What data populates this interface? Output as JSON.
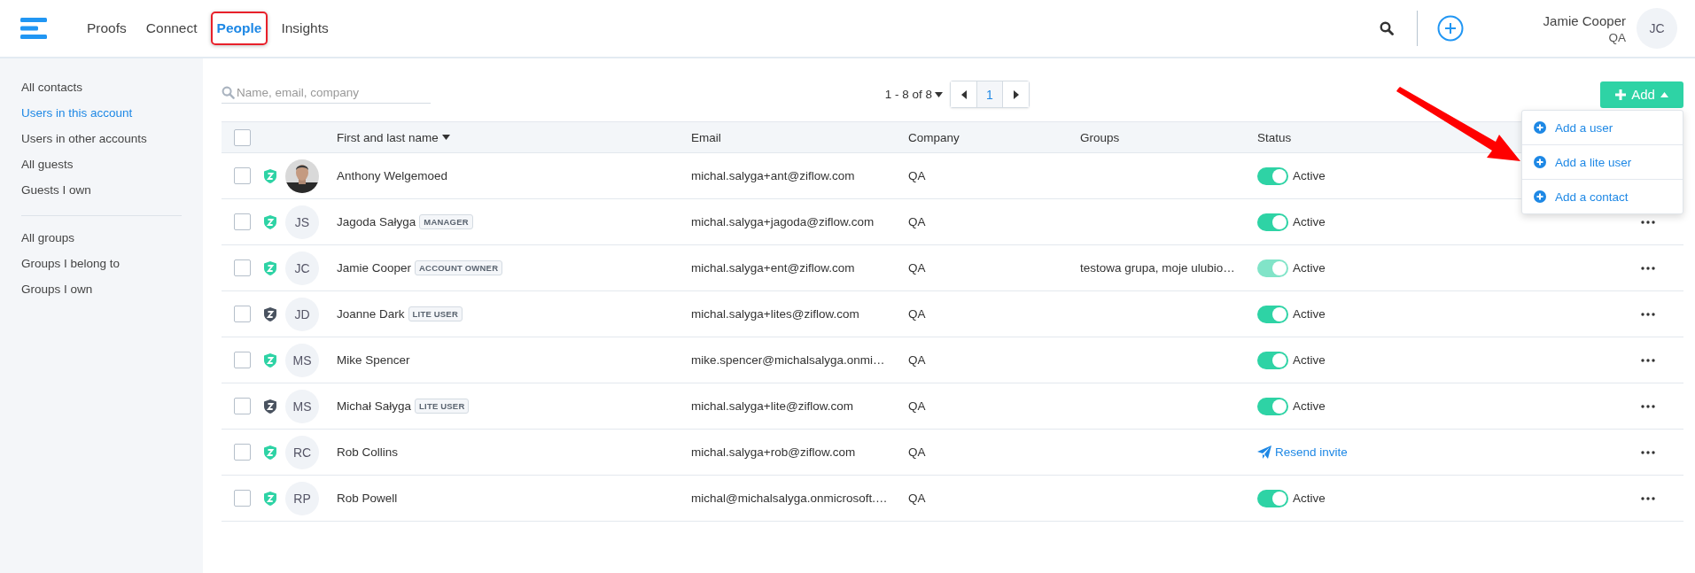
{
  "nav": {
    "items": [
      {
        "label": "Proofs",
        "selected": false,
        "highlighted": false
      },
      {
        "label": "Connect",
        "selected": false,
        "highlighted": false
      },
      {
        "label": "People",
        "selected": true,
        "highlighted": true
      },
      {
        "label": "Insights",
        "selected": false,
        "highlighted": false
      }
    ]
  },
  "user": {
    "name": "Jamie Cooper",
    "org": "QA",
    "initials": "JC"
  },
  "sidebar": {
    "sections": [
      [
        {
          "label": "All contacts",
          "selected": false
        },
        {
          "label": "Users in this account",
          "selected": true
        },
        {
          "label": "Users in other accounts",
          "selected": false
        },
        {
          "label": "All guests",
          "selected": false
        },
        {
          "label": "Guests I own",
          "selected": false
        }
      ],
      [
        {
          "label": "All groups",
          "selected": false
        },
        {
          "label": "Groups I belong to",
          "selected": false
        },
        {
          "label": "Groups I own",
          "selected": false
        }
      ]
    ]
  },
  "search": {
    "placeholder": "Name, email, company"
  },
  "pager": {
    "range": "1 - 8 of 8",
    "page": "1"
  },
  "add_button": {
    "label": "Add",
    "expanded": true
  },
  "add_menu": [
    {
      "label": "Add a user"
    },
    {
      "label": "Add a lite user"
    },
    {
      "label": "Add a contact"
    }
  ],
  "table": {
    "select_all_checked": false,
    "columns": [
      "First and last name",
      "Email",
      "Company",
      "Groups",
      "Status"
    ],
    "rows": [
      {
        "name": "Anthony Welgemoed",
        "color": "#2ed3a5",
        "checked": false,
        "email": "michal.salyga+ant@ziflow.com",
        "company": "QA",
        "status": {
          "kind": "toggle",
          "on": true,
          "disabled": false,
          "label": "Active"
        }
      },
      {
        "name": "Jagoda Sałyga",
        "badge": "MANAGER",
        "avatar": {
          "kind": "initials",
          "initials": "JS"
        },
        "color": "#2ed3a5",
        "checked": false,
        "email": "michal.salyga+jagoda@ziflow.com",
        "company": "QA",
        "status": {
          "kind": "toggle",
          "on": true,
          "disabled": false,
          "label": "Active"
        }
      },
      {
        "name": "Jamie Cooper",
        "badge": "ACCOUNT OWNER",
        "avatar": {
          "kind": "initials",
          "initials": "JC"
        },
        "color": "#2ed3a5",
        "checked": false,
        "email": "michal.salyga+ent@ziflow.com",
        "company": "QA",
        "groups": "testowa grupa, moje ulubio…",
        "status": {
          "kind": "toggle",
          "on": true,
          "disabled": true,
          "label": "Active"
        }
      },
      {
        "name": "Joanne Dark",
        "badge": "LITE USER",
        "avatar": {
          "kind": "initials",
          "initials": "JD"
        },
        "color": "#4a5360",
        "checked": false,
        "email": "michal.salyga+lites@ziflow.com",
        "company": "QA",
        "status": {
          "kind": "toggle",
          "on": true,
          "disabled": false,
          "label": "Active"
        }
      },
      {
        "name": "Mike Spencer",
        "avatar": {
          "kind": "initials",
          "initials": "MS"
        },
        "color": "#2ed3a5",
        "checked": false,
        "email": "mike.spencer@michalsalyga.onmi…",
        "company": "QA",
        "status": {
          "kind": "toggle",
          "on": true,
          "disabled": false,
          "label": "Active"
        }
      },
      {
        "name": "Michał Sałyga",
        "badge": "LITE USER",
        "avatar": {
          "kind": "initials",
          "initials": "MS"
        },
        "color": "#4a5360",
        "checked": false,
        "email": "michal.salyga+lite@ziflow.com",
        "company": "QA",
        "status": {
          "kind": "toggle",
          "on": true,
          "disabled": false,
          "label": "Active"
        }
      },
      {
        "name": "Rob Collins",
        "avatar": {
          "kind": "initials",
          "initials": "RC"
        },
        "color": "#2ed3a5",
        "checked": false,
        "email": "michal.salyga+rob@ziflow.com",
        "company": "QA",
        "status": {
          "kind": "resend",
          "label": "Resend invite"
        }
      },
      {
        "name": "Rob Powell",
        "avatar": {
          "kind": "initials",
          "initials": "RP"
        },
        "color": "#2ed3a5",
        "checked": false,
        "email": "michal@michalsalyga.onmicrosoft.…",
        "company": "QA",
        "status": {
          "kind": "toggle",
          "on": true,
          "disabled": false,
          "label": "Active"
        }
      }
    ]
  },
  "annotation": {
    "arrow": true
  }
}
